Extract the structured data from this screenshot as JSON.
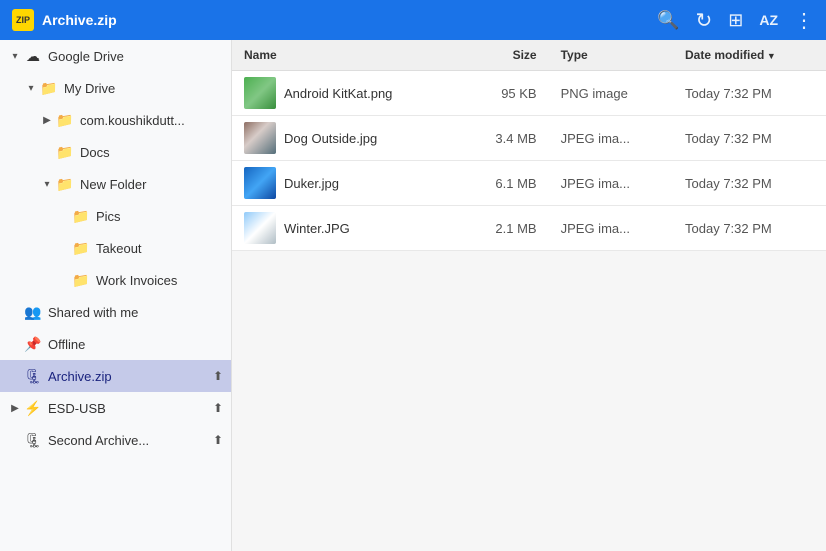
{
  "titlebar": {
    "title": "Archive.zip",
    "app_icon": "ZIP",
    "icons": {
      "search": "🔍",
      "refresh": "↻",
      "grid": "⊞",
      "sort": "AZ",
      "menu": "⋮"
    }
  },
  "sidebar": {
    "items": [
      {
        "id": "google-drive",
        "label": "Google Drive",
        "icon": "☁",
        "indent": 0,
        "toggle": "▾",
        "active": false
      },
      {
        "id": "my-drive",
        "label": "My Drive",
        "icon": "📁",
        "indent": 1,
        "toggle": "▾",
        "active": false
      },
      {
        "id": "com-koushikdutt",
        "label": "com.koushikdutt...",
        "icon": "📁",
        "indent": 2,
        "toggle": "▶",
        "active": false
      },
      {
        "id": "docs",
        "label": "Docs",
        "icon": "📁",
        "indent": 2,
        "toggle": "",
        "active": false
      },
      {
        "id": "new-folder",
        "label": "New Folder",
        "icon": "📁",
        "indent": 2,
        "toggle": "▾",
        "active": false
      },
      {
        "id": "pics",
        "label": "Pics",
        "icon": "📁",
        "indent": 3,
        "toggle": "",
        "active": false
      },
      {
        "id": "takeout",
        "label": "Takeout",
        "icon": "📁",
        "indent": 3,
        "toggle": "",
        "active": false
      },
      {
        "id": "work-invoices",
        "label": "Work Invoices",
        "icon": "📁",
        "indent": 3,
        "toggle": "",
        "active": false
      },
      {
        "id": "shared-with-me",
        "label": "Shared with me",
        "icon": "👥",
        "indent": 0,
        "toggle": "",
        "active": false
      },
      {
        "id": "offline",
        "label": "Offline",
        "icon": "📌",
        "indent": 0,
        "toggle": "",
        "active": false
      },
      {
        "id": "archive-zip",
        "label": "Archive.zip",
        "icon": "🗜",
        "indent": 0,
        "toggle": "",
        "active": true,
        "eject": "⬆"
      },
      {
        "id": "esd-usb",
        "label": "ESD-USB",
        "icon": "⚡",
        "indent": 0,
        "toggle": "▶",
        "active": false,
        "eject": "⬆"
      },
      {
        "id": "second-archive",
        "label": "Second Archive...",
        "icon": "🗜",
        "indent": 0,
        "toggle": "",
        "active": false,
        "eject": "⬆"
      }
    ]
  },
  "table": {
    "columns": [
      {
        "id": "name",
        "label": "Name",
        "sorted": false
      },
      {
        "id": "size",
        "label": "Size",
        "sorted": false
      },
      {
        "id": "type",
        "label": "Type",
        "sorted": false
      },
      {
        "id": "date",
        "label": "Date modified",
        "sorted": true
      }
    ],
    "rows": [
      {
        "id": "android-kitkat",
        "name": "Android KitKat.png",
        "size": "95 KB",
        "type": "PNG image",
        "date": "Today 7:32 PM",
        "thumb": "androidkitkat"
      },
      {
        "id": "dog-outside",
        "name": "Dog Outside.jpg",
        "size": "3.4 MB",
        "type": "JPEG ima...",
        "date": "Today 7:32 PM",
        "thumb": "dogoutside"
      },
      {
        "id": "duker",
        "name": "Duker.jpg",
        "size": "6.1 MB",
        "type": "JPEG ima...",
        "date": "Today 7:32 PM",
        "thumb": "duker"
      },
      {
        "id": "winter",
        "name": "Winter.JPG",
        "size": "2.1 MB",
        "type": "JPEG ima...",
        "date": "Today 7:32 PM",
        "thumb": "winter"
      }
    ]
  },
  "colors": {
    "titlebar_bg": "#1a73e8",
    "sidebar_active_bg": "#c5cae9",
    "accent": "#3f51b5"
  }
}
